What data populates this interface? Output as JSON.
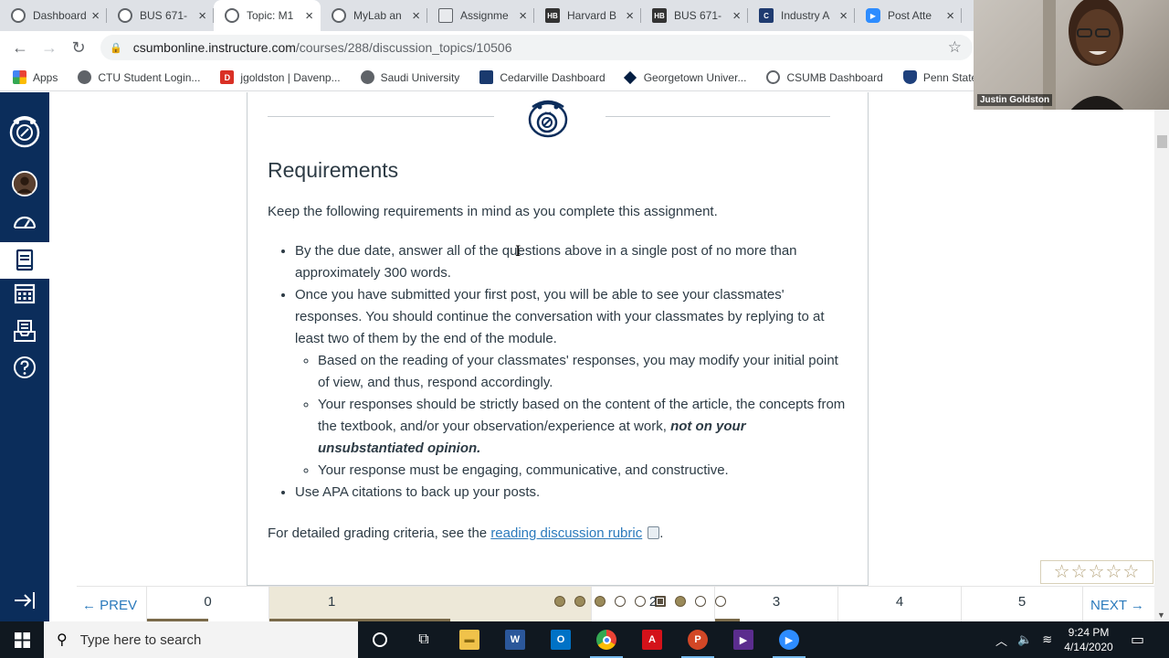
{
  "browser": {
    "tabs": [
      {
        "title": "Dashboard",
        "icon": "paw-icon",
        "active": false
      },
      {
        "title": "BUS 671-",
        "icon": "paw-icon",
        "active": false
      },
      {
        "title": "Topic: M1",
        "icon": "paw-icon",
        "active": true
      },
      {
        "title": "MyLab an",
        "icon": "paw-icon",
        "active": false
      },
      {
        "title": "Assignme",
        "icon": "doc-icon",
        "active": false
      },
      {
        "title": "Harvard B",
        "icon": "hb-icon",
        "active": false
      },
      {
        "title": "BUS 671-",
        "icon": "hb-icon",
        "active": false
      },
      {
        "title": "Industry A",
        "icon": "c-icon",
        "active": false
      },
      {
        "title": "Post Atte",
        "icon": "zoom-icon",
        "active": false
      }
    ],
    "url_host": "csumbonline.instructure.com",
    "url_path": "/courses/288/discussion_topics/10506",
    "bookmarks": [
      {
        "label": "Apps",
        "icon": "apps-grid-icon"
      },
      {
        "label": "CTU Student Login...",
        "icon": "globe-icon"
      },
      {
        "label": "jgoldston | Davenp...",
        "icon": "davenport-icon"
      },
      {
        "label": "Saudi University",
        "icon": "globe-icon"
      },
      {
        "label": "Cedarville Dashboard",
        "icon": "cedarville-icon"
      },
      {
        "label": "Georgetown Univer...",
        "icon": "georgetown-icon"
      },
      {
        "label": "CSUMB Dashboard",
        "icon": "paw-icon"
      },
      {
        "label": "Penn State Web",
        "icon": "pennstate-icon"
      }
    ]
  },
  "content": {
    "title": "Requirements",
    "intro": "Keep the following requirements in mind as you complete this assignment.",
    "bullets": {
      "b1": "By the due date, answer all of the questions above in a single post of no more than approximately 300 words.",
      "b2": "Once you have submitted your first post, you will be able to see your classmates' responses. You should continue the conversation with your classmates by replying to at least two of them by the end of the module.",
      "s1": "Based on the reading of your classmates' responses, you may modify your initial point of view, and thus, respond accordingly.",
      "s2_pre": "Your responses should be strictly based on the content of the article, the concepts from the textbook,  and/or your observation/experience at work, ",
      "s2_em": "not on your unsubstantiated opinion.",
      "s3": "Your response must be engaging, communicative, and constructive.",
      "b3": "Use APA citations to back up your posts."
    },
    "rubric_pre": "For detailed grading criteria, see the ",
    "rubric_link": "reading discussion rubric",
    "rubric_post": "."
  },
  "rating": {
    "stars": "☆☆☆☆☆",
    "value": 0,
    "max": 5
  },
  "pager": {
    "prev": "← PREV",
    "next": "NEXT →",
    "cells": [
      "0",
      "1",
      "2",
      "3",
      "4",
      "5"
    ],
    "dots": [
      "filled",
      "filled",
      "filled",
      "empty",
      "empty",
      "current",
      "filled",
      "empty",
      "empty"
    ]
  },
  "webcam": {
    "name": "Justin Goldston"
  },
  "taskbar": {
    "search_placeholder": "Type here to search",
    "time": "9:24 PM",
    "date": "4/14/2020"
  },
  "colors": {
    "canvas_nav": "#0b2d5b",
    "link": "#2b7abc",
    "text": "#2d3b45"
  }
}
